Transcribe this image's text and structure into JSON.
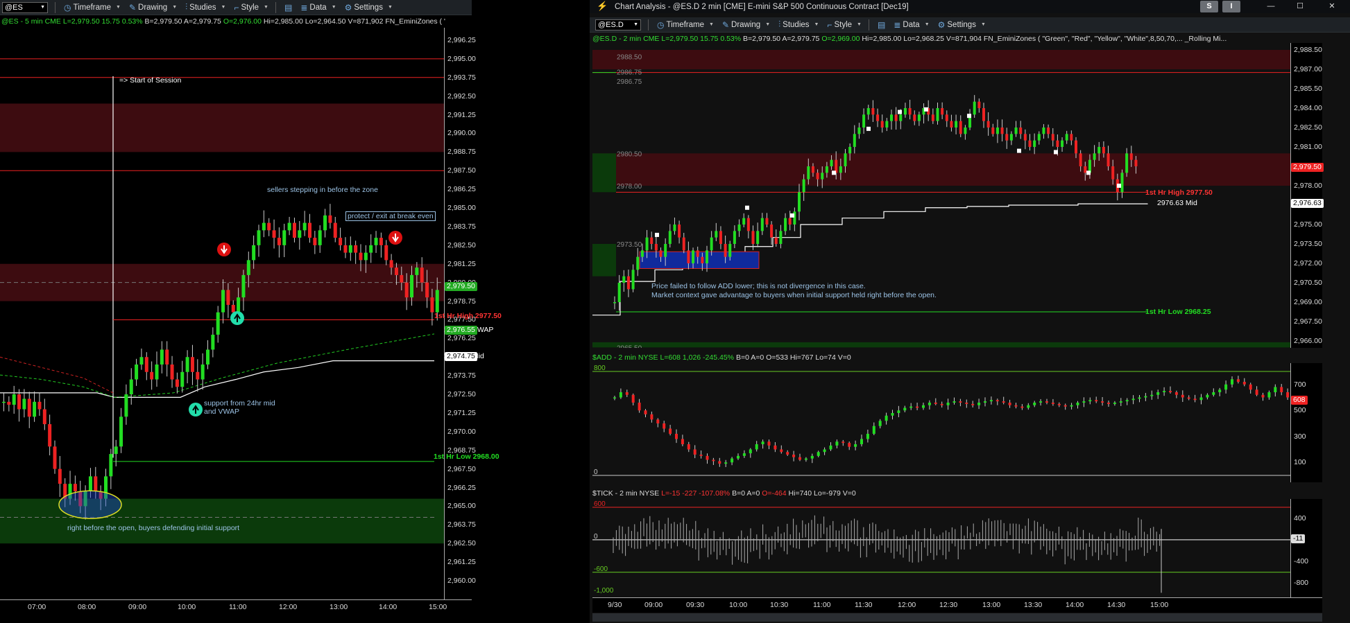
{
  "left_window": {
    "toolbar": {
      "symbol": "@ES",
      "timeframe": "Timeframe",
      "drawing": "Drawing",
      "studies": "Studies",
      "style": "Style",
      "data": "Data",
      "settings": "Settings"
    },
    "header": {
      "sym": "@ES - 5 min  CME",
      "last": "L=2,979.50  15.75  0.53%",
      "bid": "B=2,979.50",
      "ask": "A=2,979.75",
      "open": "O=2,976.00",
      "rest": "Hi=2,985.00  Lo=2,964.50  V=871,902  FN_EminiZones ( \"Green\", \"Red\", \"..."
    },
    "price_labels": [
      "2,996.25",
      "2,995.00",
      "2,993.75",
      "2,992.50",
      "2,991.25",
      "2,990.00",
      "2,988.75",
      "2,987.50",
      "2,986.25",
      "2,985.00",
      "2,983.75",
      "2,982.50",
      "2,981.25",
      "2,980.00",
      "2,978.75",
      "2,977.50",
      "2,976.25",
      "2,975.00",
      "2,973.75",
      "2,972.50",
      "2,971.25",
      "2,970.00",
      "2,968.75",
      "2,967.50",
      "2,966.25",
      "2,965.00",
      "2,963.75",
      "2,962.50",
      "2,961.25",
      "2,960.00"
    ],
    "time_labels": [
      "07:00",
      "08:00",
      "09:00",
      "10:00",
      "11:00",
      "12:00",
      "13:00",
      "14:00",
      "15:00"
    ],
    "tags": {
      "last_price": "2,979.50",
      "vwap": "2,976.55",
      "mid": "2,974.75"
    },
    "annotations": {
      "session_start": "=> Start of Session",
      "sellers": "sellers stepping in before the zone",
      "protect": "protect / exit at break even",
      "first_hr_high": "1st Hr High 2977.50",
      "vwap_label": "2976.55 VWAP",
      "mid_label": "2974.75 Mid",
      "support_1": "support from 24hr mid",
      "support_2": "and VWAP",
      "first_hr_low": "1st Hr Low 2968.00",
      "open_note": "right before the open, buyers defending initial support"
    }
  },
  "right_window": {
    "title": "Chart Analysis - @ES.D 2 min [CME] E-mini S&P 500 Continuous Contract [Dec19]",
    "title_buttons": [
      "S",
      "I"
    ],
    "toolbar": {
      "symbol": "@ES.D",
      "timeframe": "Timeframe",
      "drawing": "Drawing",
      "studies": "Studies",
      "style": "Style",
      "data": "Data",
      "settings": "Settings"
    },
    "header": {
      "sym": "@ES.D - 2 min  CME",
      "last": "L=2,979.50  15.75  0.53%",
      "bid": "B=2,979.50",
      "ask": "A=2,979.75",
      "open": "O=2,969.00",
      "rest": "Hi=2,985.00  Lo=2,968.25  V=871,904  FN_EminiZones ( \"Green\", \"Red\", \"Yellow\", \"White\",8,50,70,...  _Rolling Mi..."
    },
    "price_labels": [
      "2,988.50",
      "2,987.00",
      "2,985.50",
      "2,984.00",
      "2,982.50",
      "2,981.00",
      "2,979.50",
      "2,978.00",
      "2,976.50",
      "2,975.00",
      "2,973.50",
      "2,972.00",
      "2,970.50",
      "2,969.00",
      "2,967.50",
      "2,966.00"
    ],
    "zone_labels": [
      "2988.50",
      "2986.75",
      "2986.75",
      "2980.50",
      "2978.00",
      "2973.50",
      "2965.50"
    ],
    "tags": {
      "last_price": "2,979.50",
      "mid": "2,976.63"
    },
    "annotations": {
      "first_hr_high": "1st Hr High 2977.50",
      "mid_label": "2976.63 Mid",
      "first_hr_low": "1st Hr Low 2968.25",
      "note_1": "Price failed to follow ADD lower; this is not divergence in this case.",
      "note_2": "Market context gave advantage to buyers when initial support held right before the open."
    },
    "add_panel": {
      "header_sym": "$ADD - 2 min  NYSE",
      "header_last": "L=608  1,026  -245.45%",
      "header_rest": "B=0  A=0  O=533  Hi=767  Lo=74  V=0",
      "labels": [
        "700",
        "500",
        "300",
        "100"
      ],
      "tag": "608",
      "level_800": "800",
      "level_0": "0"
    },
    "tick_panel": {
      "header_sym": "$TICK - 2 min  NYSE",
      "header_last": "L=-15   -227   -107.08%",
      "header_b": "B=0  A=0",
      "header_open": "O=-464",
      "header_rest": "Hi=740  Lo=-979  V=0",
      "labels": [
        "400",
        "-400",
        "-800"
      ],
      "tag": "-11",
      "level_600": "600",
      "level_0": "0",
      "level_m600": "-600",
      "level_m1000": "-1,000"
    },
    "time_labels": [
      "9/30",
      "09:00",
      "09:30",
      "10:00",
      "10:30",
      "11:00",
      "11:30",
      "12:00",
      "12:30",
      "13:00",
      "13:30",
      "14:00",
      "14:30",
      "15:00"
    ]
  },
  "colors": {
    "up": "#22dd22",
    "down": "#ee2222",
    "zone_red": "#4a0d10",
    "zone_green": "#0c3a0c",
    "accent_blue": "#6fa8dc"
  }
}
